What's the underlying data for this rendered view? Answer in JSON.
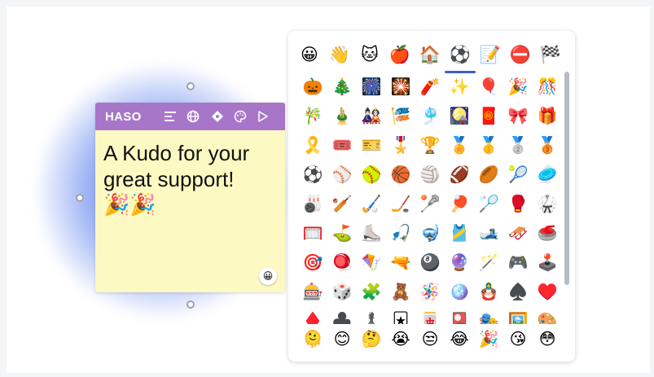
{
  "note": {
    "title": "HASO",
    "text": "A Kudo for your great support!",
    "emoji": "🎉🎉",
    "reaction_icon": "😀",
    "header_color": "#a776c9",
    "body_color": "#fdf9c2"
  },
  "picker": {
    "categories": [
      "😀",
      "👋",
      "🐱",
      "🍎",
      "🏠",
      "⚽",
      "📝",
      "⛔",
      "🏁"
    ],
    "active_category_index": 5,
    "accent_color": "#3f5fbf",
    "rows": [
      [
        "🎃",
        "🎄",
        "🎆",
        "🎇",
        "🧨",
        "✨",
        "🎈",
        "🎉",
        "🎊"
      ],
      [
        "🎋",
        "🎍",
        "🎎",
        "🎏",
        "🎐",
        "🎑",
        "🧧",
        "🎀",
        "🎁"
      ],
      [
        "🎗️",
        "🎟️",
        "🎫",
        "🎖️",
        "🏆",
        "🏅",
        "🥇",
        "🥈",
        "🥉"
      ],
      [
        "⚽",
        "⚾",
        "🥎",
        "🏀",
        "🏐",
        "🏈",
        "🏉",
        "🎾",
        "🥏"
      ],
      [
        "🎳",
        "🏏",
        "🏑",
        "🏒",
        "🥍",
        "🏓",
        "🏸",
        "🥊",
        "🥋"
      ],
      [
        "🥅",
        "⛳",
        "⛸️",
        "🎣",
        "🤿",
        "🎽",
        "🎿",
        "🛷",
        "🥌"
      ],
      [
        "🎯",
        "🪀",
        "🪁",
        "🔫",
        "🎱",
        "🔮",
        "🪄",
        "🎮",
        "🕹️"
      ],
      [
        "🎰",
        "🎲",
        "🧩",
        "🧸",
        "🪅",
        "🪩",
        "🪆",
        "♠️",
        "♥️"
      ],
      [
        "♦️",
        "♣️",
        "♟️",
        "🃏",
        "🀄",
        "🎴",
        "🎭",
        "🖼️",
        "🎨"
      ]
    ],
    "recent": [
      "🫠",
      "😊",
      "🤔",
      "😭",
      "😒",
      "😂",
      "🎉",
      "😘",
      "😳"
    ]
  }
}
